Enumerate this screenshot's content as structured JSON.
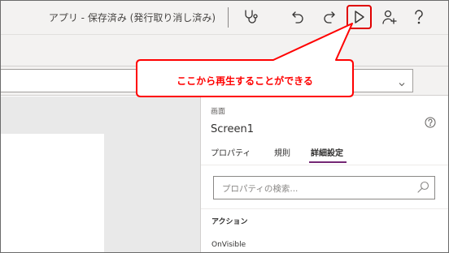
{
  "titlebar": {
    "app_title": "アプリ - 保存済み (発行取り消し済み)",
    "icons": [
      "stethoscope-icon",
      "undo-icon",
      "redo-icon",
      "play-icon",
      "share-user-icon",
      "help-icon"
    ]
  },
  "annotation": {
    "callout_text": "ここから再生することができる",
    "highlight_color": "#e00000"
  },
  "properties_panel": {
    "type_label": "画面",
    "control_name": "Screen1",
    "tabs": [
      {
        "label": "プロパティ"
      },
      {
        "label": "規則"
      },
      {
        "label": "詳細設定",
        "active": true
      }
    ],
    "search_placeholder": "プロパティの検索...",
    "section_title": "アクション",
    "property_name": "OnVisible"
  },
  "colors": {
    "accent": "#742774",
    "annotation_red": "#ff0000"
  }
}
